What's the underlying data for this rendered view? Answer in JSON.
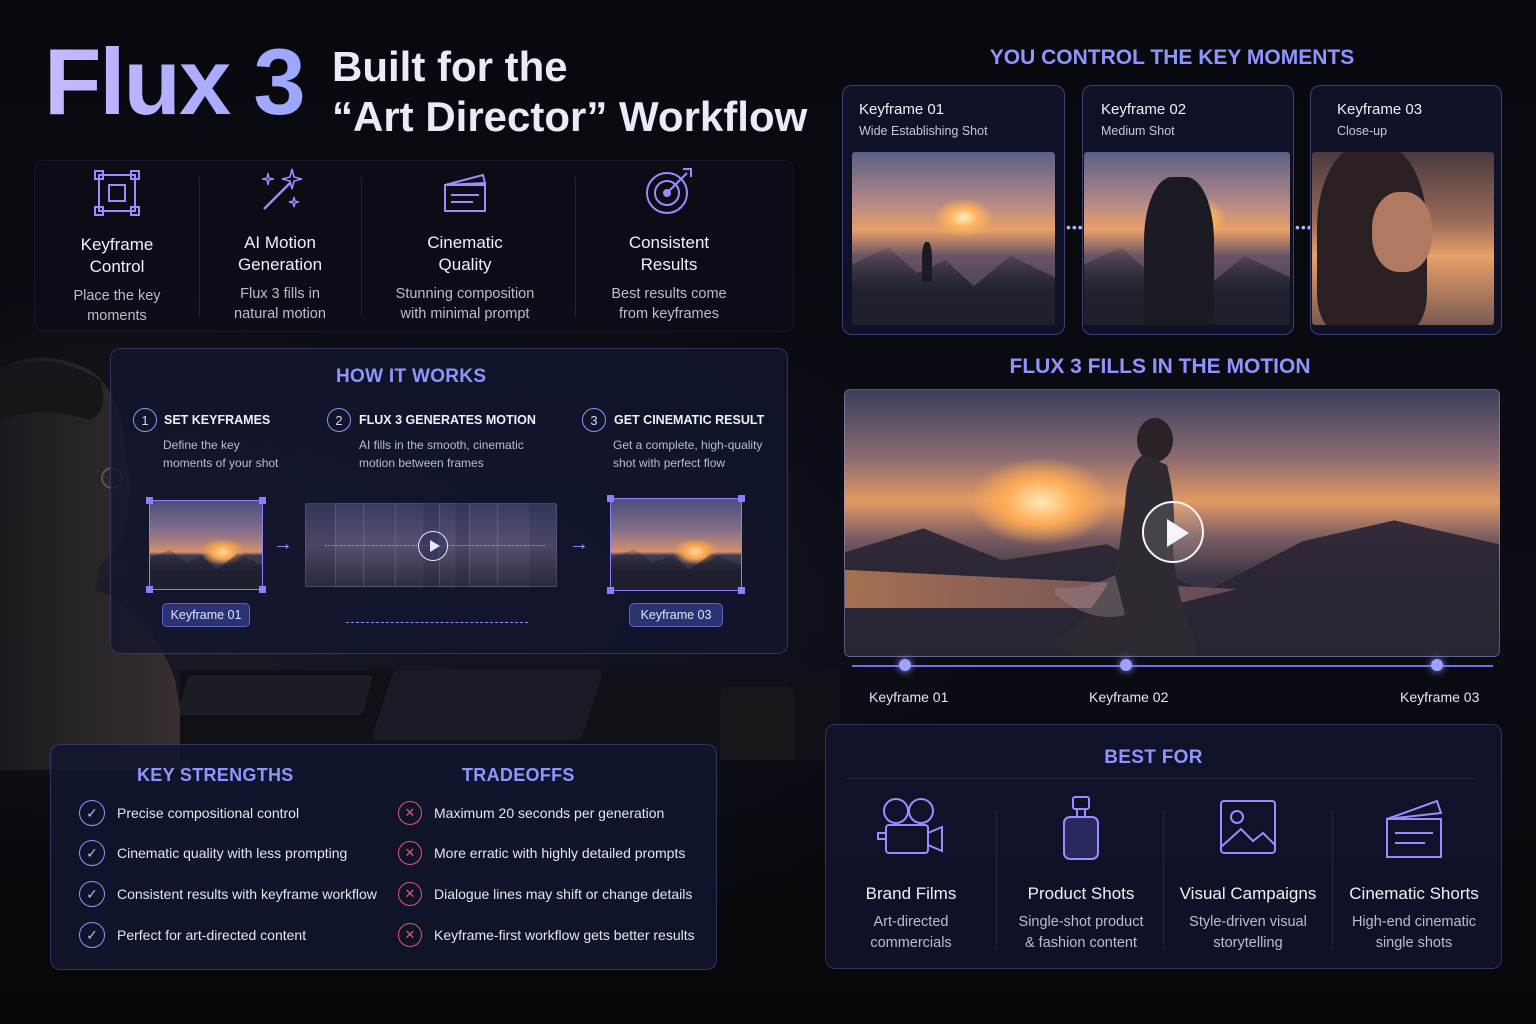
{
  "header": {
    "brand": "Flux 3",
    "subtitle": "Built for the\n“Art Director” Workflow"
  },
  "features": [
    {
      "icon": "keyframe-frame-icon",
      "title": "Keyframe\nControl",
      "desc": "Place the key\nmoments"
    },
    {
      "icon": "magic-wand-icon",
      "title": "AI Motion\nGeneration",
      "desc": "Flux 3 fills in\nnatural motion"
    },
    {
      "icon": "clapperboard-icon",
      "title": "Cinematic\nQuality",
      "desc": "Stunning composition\nwith minimal prompt"
    },
    {
      "icon": "target-icon",
      "title": "Consistent\nResults",
      "desc": "Best results come\nfrom keyframes"
    }
  ],
  "how_it_works": {
    "title": "HOW IT WORKS",
    "steps": [
      {
        "num": "1",
        "title": "SET KEYFRAMES",
        "desc": "Define the key\nmoments of your shot"
      },
      {
        "num": "2",
        "title": "FLUX 3 GENERATES MOTION",
        "desc": "AI fills in the smooth, cinematic\nmotion between frames"
      },
      {
        "num": "3",
        "title": "GET CINEMATIC RESULT",
        "desc": "Get a complete, high-quality\nshot with perfect flow"
      }
    ],
    "tag_start": "Keyframe 01",
    "tag_end": "Keyframe 03"
  },
  "strengths": {
    "title": "KEY STRENGTHS",
    "items": [
      "Precise compositional control",
      "Cinematic quality with less prompting",
      "Consistent results with keyframe workflow",
      "Perfect for art-directed content"
    ]
  },
  "tradeoffs": {
    "title": "TRADEOFFS",
    "items": [
      "Maximum 20 seconds per generation",
      "More erratic with highly detailed prompts",
      "Dialogue lines may shift or change details",
      "Keyframe-first workflow gets better results"
    ]
  },
  "control": {
    "title": "YOU CONTROL THE KEY MOMENTS",
    "cards": [
      {
        "title": "Keyframe 01",
        "sub": "Wide Establishing Shot"
      },
      {
        "title": "Keyframe 02",
        "sub": "Medium Shot"
      },
      {
        "title": "Keyframe 03",
        "sub": "Close-up"
      }
    ]
  },
  "motion": {
    "title": "FLUX 3 FILLS IN THE MOTION",
    "timeline_labels": [
      "Keyframe 01",
      "Keyframe 02",
      "Keyframe 03"
    ]
  },
  "best_for": {
    "title": "BEST FOR",
    "items": [
      {
        "icon": "film-camera-icon",
        "title": "Brand Films",
        "desc": "Art-directed\ncommercials"
      },
      {
        "icon": "perfume-bottle-icon",
        "title": "Product Shots",
        "desc": "Single-shot product\n& fashion content"
      },
      {
        "icon": "image-icon",
        "title": "Visual Campaigns",
        "desc": "Style-driven visual\nstorytelling"
      },
      {
        "icon": "clapperboard-icon",
        "title": "Cinematic Shorts",
        "desc": "High-end cinematic\nsingle shots"
      }
    ]
  },
  "colors": {
    "accent": "#8f95ff",
    "check": "#8f95ff",
    "cross": "#e05a6c",
    "background": "#07080d"
  }
}
